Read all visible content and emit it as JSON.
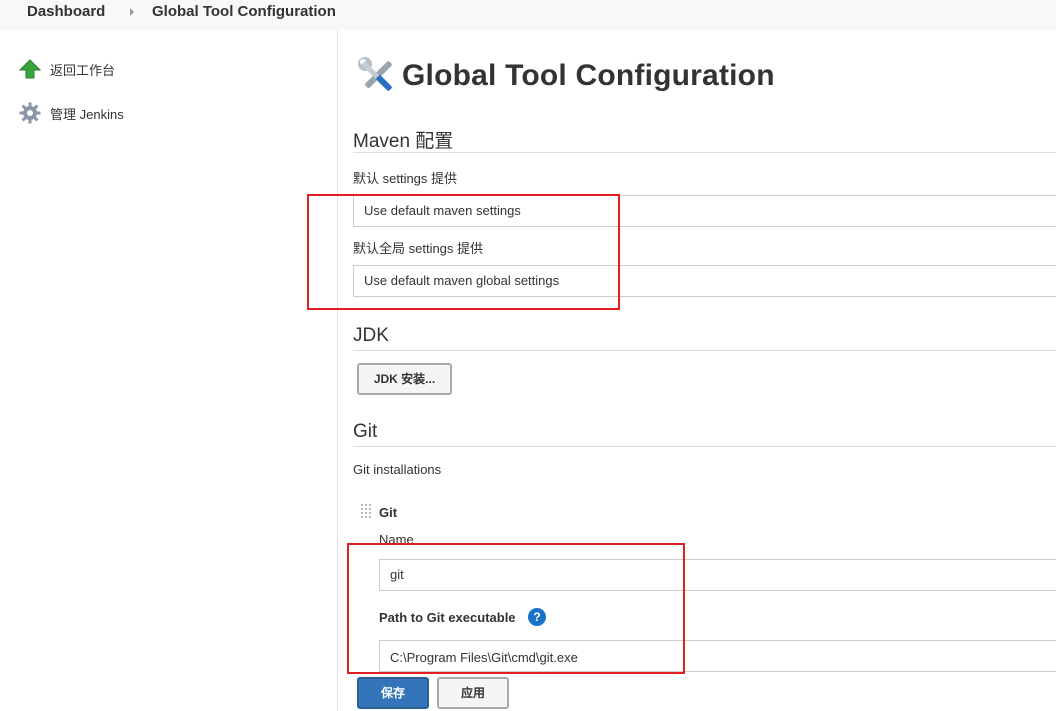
{
  "breadcrumb": {
    "items": [
      "Dashboard",
      "Global Tool Configuration"
    ]
  },
  "sidebar": {
    "items": [
      {
        "label": "返回工作台",
        "icon": "up-arrow-icon"
      },
      {
        "label": "管理 Jenkins",
        "icon": "gear-icon"
      }
    ]
  },
  "page": {
    "title": "Global Tool Configuration",
    "icon": "tools-icon"
  },
  "maven": {
    "heading": "Maven 配置",
    "settings_label": "默认 settings 提供",
    "settings_value": "Use default maven settings",
    "global_settings_label": "默认全局 settings 提供",
    "global_settings_value": "Use default maven global settings"
  },
  "jdk": {
    "heading": "JDK",
    "install_button": "JDK 安装..."
  },
  "git": {
    "heading": "Git",
    "installations_label": "Git installations",
    "entry_title": "Git",
    "name_label": "Name",
    "name_value": "git",
    "path_label": "Path to Git executable",
    "path_value": "C:\\Program Files\\Git\\cmd\\git.exe",
    "help_glyph": "?"
  },
  "actions": {
    "save": "保存",
    "apply": "应用"
  },
  "colors": {
    "highlight": "#e02020",
    "primary": "#3474b8",
    "help": "#1a73c9"
  }
}
